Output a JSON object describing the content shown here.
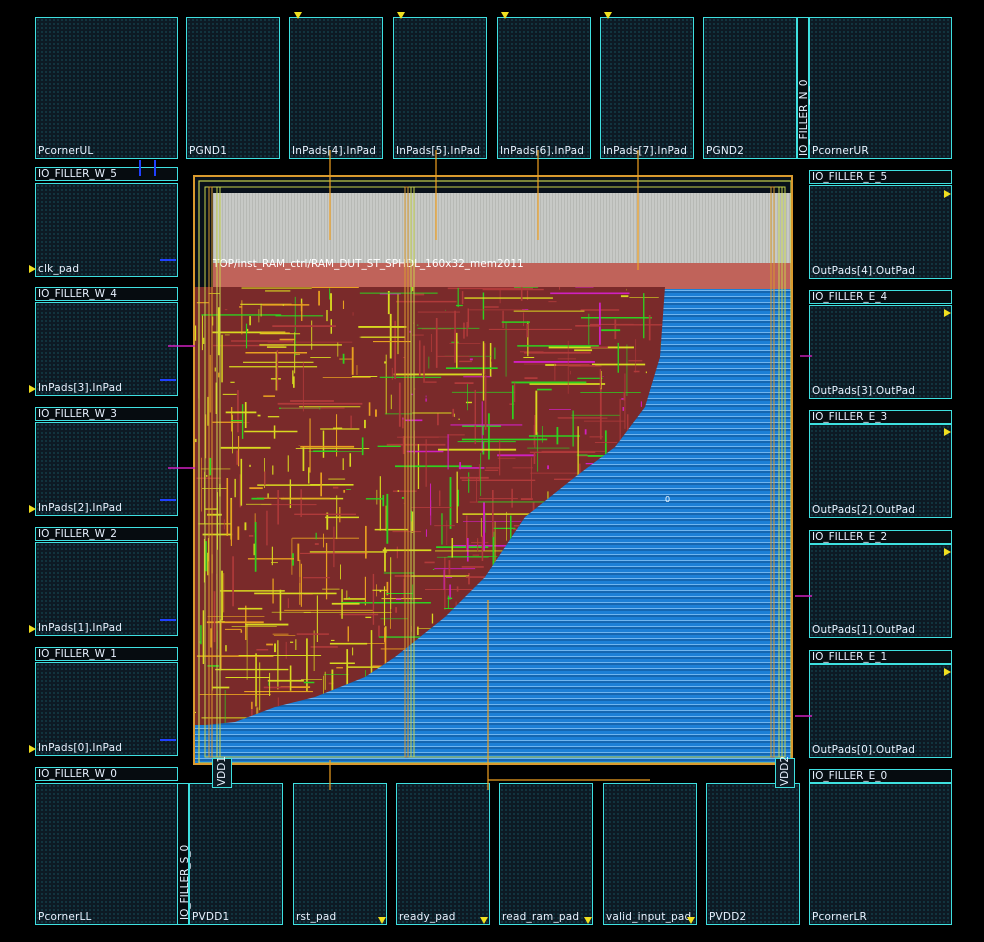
{
  "layout": {
    "corners": {
      "ul": "PcornerUL",
      "ur": "PcornerUR",
      "ll": "PcornerLL",
      "lr": "PcornerLR"
    },
    "top_pads": [
      "PGND1",
      "InPads[4].InPad",
      "InPads[5].InPad",
      "InPads[6].InPad",
      "InPads[7].InPad",
      "PGND2"
    ],
    "top_filler": "IO_FILLER_N_0",
    "west_pads": [
      "clk_pad",
      "InPads[3].InPad",
      "InPads[2].InPad",
      "InPads[1].InPad",
      "InPads[0].InPad"
    ],
    "west_fillers": [
      "IO_FILLER_W_5",
      "IO_FILLER_W_4",
      "IO_FILLER_W_3",
      "IO_FILLER_W_2",
      "IO_FILLER_W_1",
      "IO_FILLER_W_0"
    ],
    "east_pads": [
      "OutPads[4].OutPad",
      "OutPads[3].OutPad",
      "OutPads[2].OutPad",
      "OutPads[1].OutPad",
      "OutPads[0].OutPad"
    ],
    "east_fillers": [
      "IO_FILLER_E_5",
      "IO_FILLER_E_4",
      "IO_FILLER_E_3",
      "IO_FILLER_E_2",
      "IO_FILLER_E_1",
      "IO_FILLER_E_0"
    ],
    "bottom_pads": [
      "PVDD1",
      "rst_pad",
      "ready_pad",
      "read_ram_pad",
      "valid_input_pad",
      "PVDD2"
    ],
    "bottom_filler": "IO_FILLER_S_0",
    "macro_label": "TOP/inst_RAM_ctrl/RAM_DUT_ST_SPHDL_160x32_mem2011",
    "core_marker": "0",
    "vdd_left": "VDD1",
    "vdd_right": "VDD2",
    "colors": {
      "pad_border": "#3ee0e0",
      "core_border": "#d99a2e",
      "rows": "#1c7fd6",
      "route_red": "#b03a3a",
      "route_yellow": "#d8d820",
      "route_green": "#30d020",
      "route_magenta": "#d020c0",
      "route_orange": "#e8a020"
    }
  }
}
